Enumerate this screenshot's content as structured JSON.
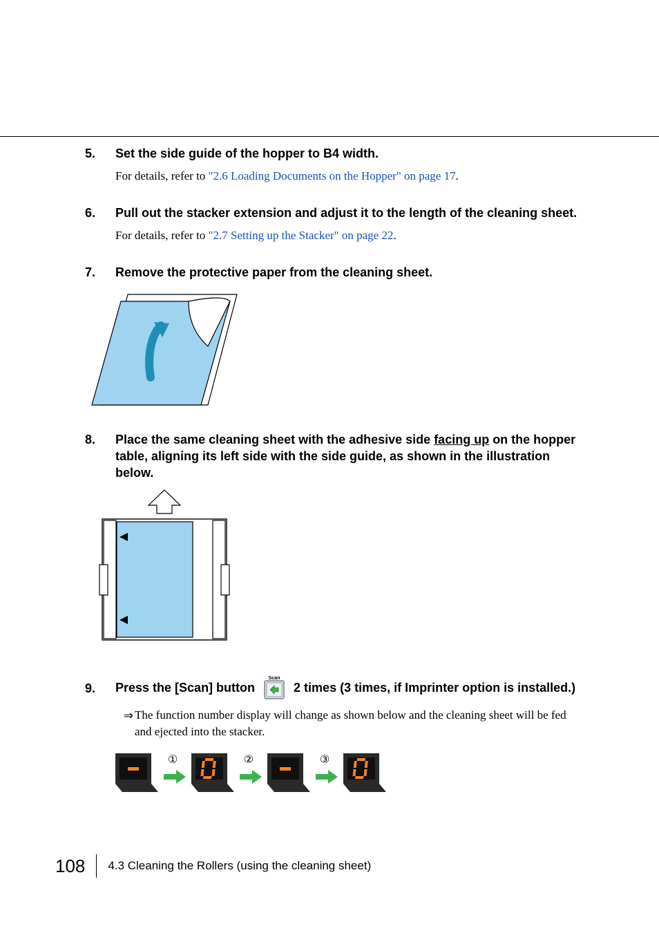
{
  "steps": {
    "s5": {
      "num": "5.",
      "title": "Set the side guide of the hopper to B4 width.",
      "body_prefix": "For details, refer to ",
      "body_link": "\"2.6 Loading Documents on the Hopper\" on page 17",
      "body_suffix": "."
    },
    "s6": {
      "num": "6.",
      "title": "Pull out the stacker extension and adjust it to the length of the cleaning sheet.",
      "body_prefix": "For details, refer to ",
      "body_link": "\"2.7 Setting up the Stacker\" on page 22",
      "body_suffix": "."
    },
    "s7": {
      "num": "7.",
      "title": "Remove the protective paper from the cleaning sheet."
    },
    "s8": {
      "num": "8.",
      "title_before_u": "Place the same cleaning sheet with the adhesive side ",
      "title_u": "facing up",
      "title_after_u": " on the hopper table, aligning its left side with the side guide, as shown in the illustration below."
    },
    "s9": {
      "num": "9.",
      "title_a": "Press the [Scan] button ",
      "title_b": " 2 times (3 times, if Imprinter option is installed.)",
      "scan_label": "Scan",
      "result": "The function number display will change as shown below and the cleaning sheet will be fed and ejected into the stacker.",
      "arrow": "⇒",
      "circled": {
        "c1": "①",
        "c2": "②",
        "c3": "③"
      }
    }
  },
  "footer": {
    "page": "108",
    "section": "4.3 Cleaning the Rollers (using the cleaning sheet)"
  },
  "colors": {
    "link": "#1a4fb3",
    "sheet": "#9fd4f0",
    "green": "#3bb34a",
    "orange": "#f58220",
    "panel": "#2a2a2a"
  }
}
